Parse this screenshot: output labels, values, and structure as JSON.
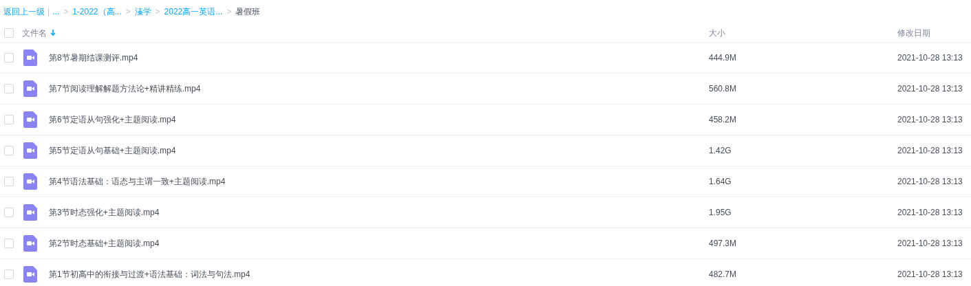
{
  "breadcrumb": {
    "back": "返回上一级",
    "divider": "|",
    "crumbs": [
      {
        "label": "...",
        "current": false
      },
      {
        "sep": ">",
        "label": "1-2022（高...",
        "current": false
      },
      {
        "sep": ">",
        "label": "溱学",
        "current": false
      },
      {
        "sep": ">",
        "label": "2022高一英语...",
        "current": false
      },
      {
        "sep": ">",
        "label": "暑假班",
        "current": true
      }
    ]
  },
  "table": {
    "columns": [
      "文件名",
      "大小",
      "修改日期"
    ],
    "header_checked": false,
    "rows": [
      {
        "checked": false,
        "name": "第8节暑期结课测评.mp4",
        "size": "444.9M",
        "modified": "2021-10-28 13:13"
      },
      {
        "checked": false,
        "name": "第7节阅读理解解题方法论+精讲精练.mp4",
        "size": "560.8M",
        "modified": "2021-10-28 13:13"
      },
      {
        "checked": false,
        "name": "第6节定语从句强化+主题阅读.mp4",
        "size": "458.2M",
        "modified": "2021-10-28 13:13"
      },
      {
        "checked": false,
        "name": "第5节定语从句基础+主题阅读.mp4",
        "size": "1.42G",
        "modified": "2021-10-28 13:13"
      },
      {
        "checked": false,
        "name": "第4节语法基础：语态与主谓一致+主题阅读.mp4",
        "size": "1.64G",
        "modified": "2021-10-28 13:13"
      },
      {
        "checked": false,
        "name": "第3节时态强化+主题阅读.mp4",
        "size": "1.95G",
        "modified": "2021-10-28 13:13"
      },
      {
        "checked": false,
        "name": "第2节时态基础+主题阅读.mp4",
        "size": "497.3M",
        "modified": "2021-10-28 13:13"
      },
      {
        "checked": false,
        "name": "第1节初高中的衔接与过渡+语法基础：词法与句法.mp4",
        "size": "482.7M",
        "modified": "2021-10-28 13:13"
      }
    ]
  }
}
